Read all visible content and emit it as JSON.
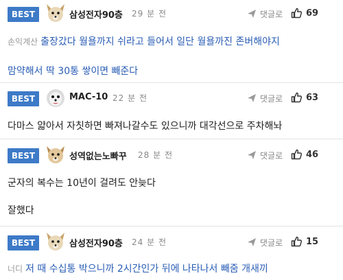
{
  "comments": [
    {
      "badge": "BEST",
      "nickname": "삼성전자90층",
      "time": "29 분 전",
      "reply_label": "댓글로",
      "likes": "69",
      "avatar_icon": "dog-avatar-icon",
      "prefix": "손익계산",
      "lines": [
        "출장갔다 월욜까지 쉬라고 들어서 일단 월욜까진 존버해야지",
        "맘약해서 딱 30통 쌓이면 빼준다"
      ]
    },
    {
      "badge": "BEST",
      "nickname": "MAC-10",
      "time": "22 분 전",
      "reply_label": "댓글로",
      "likes": "63",
      "avatar_icon": "dog-avatar-icon",
      "prefix": "",
      "lines": [
        "다마스 얇아서 자칫하면 빠져나갈수도 있으니까 대각선으로 주차해놔"
      ]
    },
    {
      "badge": "BEST",
      "nickname": "성역없는노빠꾸",
      "time": "28 분 전",
      "reply_label": "댓글로",
      "likes": "46",
      "avatar_icon": "dog-avatar-icon",
      "prefix": "",
      "lines": [
        "군자의 복수는 10년이 걸려도 안늦다",
        "잘했다"
      ]
    },
    {
      "badge": "BEST",
      "nickname": "삼성전자90층",
      "time": "24 분 전",
      "reply_label": "댓글로",
      "likes": "15",
      "avatar_icon": "dog-avatar-icon",
      "prefix": "너디",
      "lines": [
        "저 때 수십통 박으니까 2시간인가 뒤에 나타나서 빼줌 개새끼"
      ]
    }
  ],
  "colors": {
    "badge": "#3d7ac7",
    "link_text": "#2a5db5",
    "divider": "#e3e3e3"
  },
  "icons": {
    "reply": "reply-arrow-icon",
    "like": "thumbs-up-icon"
  }
}
